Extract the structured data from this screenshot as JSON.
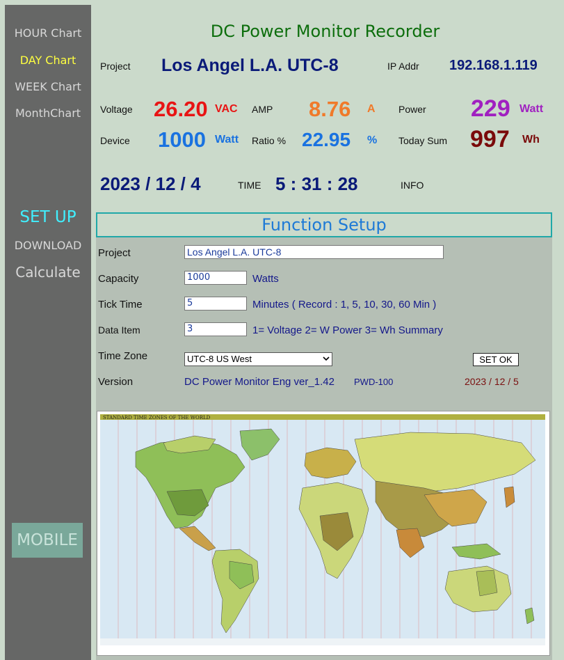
{
  "nav": {
    "hour": "HOUR Chart",
    "day": "DAY Chart",
    "week": "WEEK Chart",
    "month": "MonthChart",
    "setup": "SET UP",
    "download": "DOWNLOAD",
    "calculate": "Calculate",
    "mobile": "MOBILE"
  },
  "header": {
    "title": "DC Power Monitor Recorder",
    "project_label": "Project",
    "project_value": "Los Angel L.A. UTC-8",
    "ip_label": "IP Addr",
    "ip_value": "192.168.1.119"
  },
  "readings": {
    "voltage_label": "Voltage",
    "voltage_value": "26.20",
    "voltage_unit": "VAC",
    "amp_label": "AMP",
    "amp_value": "8.76",
    "amp_unit": "A",
    "power_label": "Power",
    "power_value": "229",
    "power_unit": "Watt",
    "device_label": "Device",
    "device_value": "1000",
    "device_unit": "Watt",
    "ratio_label": "Ratio %",
    "ratio_value": "22.95",
    "ratio_unit": "%",
    "today_label": "Today Sum",
    "today_value": "997",
    "today_unit": "Wh"
  },
  "datetime": {
    "date": "2023 / 12 / 4",
    "time_label": "TIME",
    "time": "5 : 31 : 28",
    "info_label": "INFO"
  },
  "setup": {
    "title": "Function Setup",
    "project_label": "Project",
    "project_value": "Los Angel L.A. UTC-8",
    "capacity_label": "Capacity",
    "capacity_value": "1000",
    "capacity_unit": "Watts",
    "tick_label": "Tick Time",
    "tick_value": "5",
    "tick_hint": "Minutes  ( Record : 1, 5, 10, 30, 60 Min )",
    "data_label": "Data Item",
    "data_value": "3",
    "data_hint": "1= Voltage  2= W Power  3= Wh Summary",
    "tz_label": "Time Zone",
    "tz_value": "UTC-8 US West",
    "setok": "SET OK",
    "version_label": "Version",
    "version_value": "DC Power Monitor Eng ver_1.42",
    "version_model": "PWD-100",
    "restart_date": "2023 / 12 / 5"
  },
  "map": {
    "title": "STANDARD TIME ZONES OF THE WORLD"
  },
  "colors": {
    "sidebar": "#666766",
    "background": "#cbdacb",
    "voltage": "#e81414",
    "amp": "#f07a2a",
    "power": "#a020c0",
    "device": "#1a72e0",
    "today": "#7a0a0a",
    "navy": "#0a1a78"
  }
}
